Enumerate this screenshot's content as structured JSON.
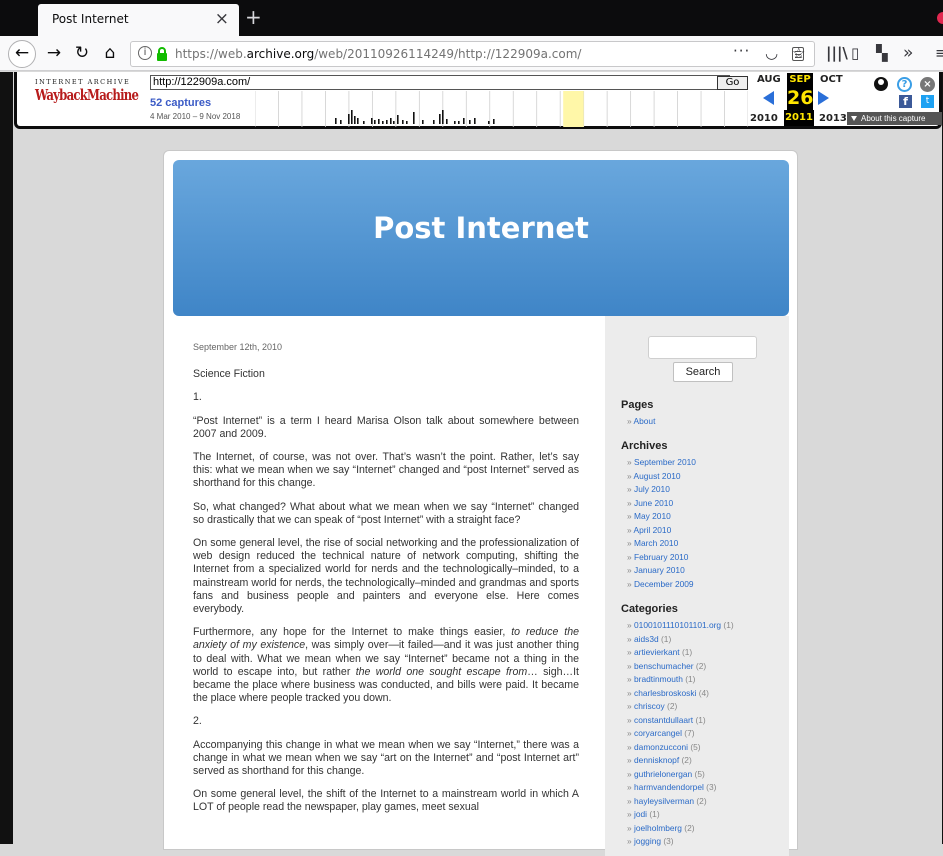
{
  "browser": {
    "tab_title": "Post Internet",
    "tab_close": "×",
    "new_tab": "+",
    "url_prefix": "https://web.",
    "url_domain": "archive.org",
    "url_path": "/web/20110926114249/http://122909a.com/",
    "icons": [
      "back-icon",
      "forward-icon",
      "reload-icon",
      "home-icon",
      "info-icon",
      "lock-icon",
      "reader-view-icon",
      "ellipsis-icon",
      "pocket-icon",
      "bookmark-star-icon",
      "library-icon",
      "sidebar-icon",
      "extension-icon",
      "overflow-icon",
      "menu-icon"
    ]
  },
  "wayback": {
    "logo_top": "INTERNET ARCHIVE",
    "logo": "WaybackMachine",
    "url_value": "http://122909a.com/",
    "go_label": "Go",
    "captures": "52 captures",
    "range": "4 Mar 2010 – 9 Nov 2018",
    "month_prev": "AUG",
    "month_cur": "SEP",
    "month_next": "OCT",
    "day": "26",
    "year_prev": "2010",
    "year_cur": "2011",
    "year_next": "2013",
    "about": "About this capture",
    "fb": "f",
    "tw": "t",
    "help": "?",
    "close": "×"
  },
  "blog": {
    "site_title": "Post Internet",
    "post_date": "September 12th, 2010",
    "post_title": "Science Fiction",
    "paragraphs": {
      "p1": "1.",
      "p2": "“Post Internet” is a term I heard Marisa Olson talk about somewhere between 2007 and 2009.",
      "p3": "The Internet, of course, was not over.  That’s wasn’t the point.  Rather, let’s say this: what we mean when we say “Internet” changed and “post Internet” served as shorthand for this change.",
      "p4": "So, what changed? What about what we mean when we say “Internet” changed so drastically that we can speak of “post Internet” with a straight face?",
      "p5": "On some general level, the rise of social networking and the professionalization of web design reduced the technical nature of network computing, shifting the Internet from a specialized world for nerds and the technologically–minded, to a mainstream world for nerds, the technologically–minded and grandmas and sports fans and business people and painters and everyone else.  Here comes everybody.",
      "p6a": "Furthermore, any hope for the Internet to make things easier,",
      "p6b": "to reduce the anxiety of my existence",
      "p6c": ", was simply over—it failed—and it was just another thing to deal with.  What we mean when we say “Internet” became not a thing in the world to escape into, but rather",
      "p6d": "the world one sought escape from",
      "p6e": "… sigh…It became the place where business was conducted, and bills were paid.  It became the place where people tracked you down.",
      "p7": "2.",
      "p8": "Accompanying this change in what we mean when we say “Internet,” there was a change in what we mean when we say “art on the Internet” and “post Internet art” served as shorthand for this change.",
      "p9": "On some general level, the shift of the Internet to a mainstream world in which A LOT of people read the newspaper, play games, meet sexual"
    }
  },
  "sidebar": {
    "search_label": "Search",
    "pages_heading": "Pages",
    "pages": [
      {
        "label": "About"
      }
    ],
    "archives_heading": "Archives",
    "archives": [
      {
        "label": "September 2010"
      },
      {
        "label": "August 2010"
      },
      {
        "label": "July 2010"
      },
      {
        "label": "June 2010"
      },
      {
        "label": "May 2010"
      },
      {
        "label": "April 2010"
      },
      {
        "label": "March 2010"
      },
      {
        "label": "February 2010"
      },
      {
        "label": "January 2010"
      },
      {
        "label": "December 2009"
      }
    ],
    "categories_heading": "Categories",
    "categories": [
      {
        "label": "0100101110101101.org",
        "count": "(1)"
      },
      {
        "label": "aids3d",
        "count": "(1)"
      },
      {
        "label": "artievierkant",
        "count": "(1)"
      },
      {
        "label": "benschumacher",
        "count": "(2)"
      },
      {
        "label": "bradtinmouth",
        "count": "(1)"
      },
      {
        "label": "charlesbroskoski",
        "count": "(4)"
      },
      {
        "label": "chriscoy",
        "count": "(2)"
      },
      {
        "label": "constantdullaart",
        "count": "(1)"
      },
      {
        "label": "coryarcangel",
        "count": "(7)"
      },
      {
        "label": "damonzucconi",
        "count": "(5)"
      },
      {
        "label": "dennisknopf",
        "count": "(2)"
      },
      {
        "label": "guthrielonergan",
        "count": "(5)"
      },
      {
        "label": "harmvandendorpel",
        "count": "(3)"
      },
      {
        "label": "hayleysilverman",
        "count": "(2)"
      },
      {
        "label": "jodi",
        "count": "(1)"
      },
      {
        "label": "joelholmberg",
        "count": "(2)"
      },
      {
        "label": "jogging",
        "count": "(3)"
      }
    ]
  },
  "colors": {
    "banner": "#4f93d2",
    "link": "#2a6ac7",
    "wayback_highlight": "#ffe600"
  }
}
